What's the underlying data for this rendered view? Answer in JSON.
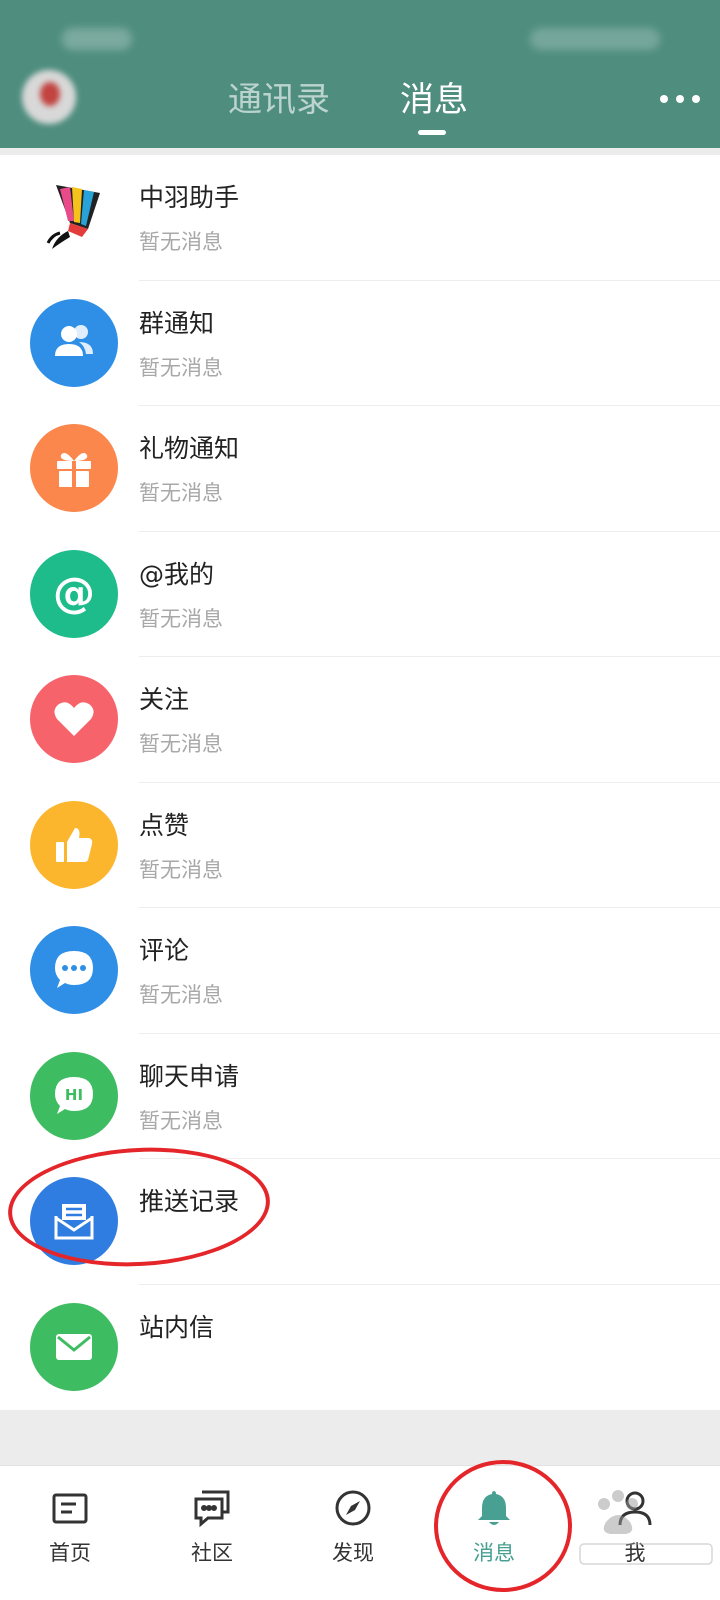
{
  "header": {
    "tabs": [
      {
        "label": "通讯录",
        "active": false
      },
      {
        "label": "消息",
        "active": true
      }
    ],
    "more_icon": "more-dots-icon",
    "background": "#4f8e7f"
  },
  "messages": [
    {
      "title": "中羽助手",
      "subtitle": "暂无消息",
      "icon": "shuttlecock-icon",
      "color": "#ffffff"
    },
    {
      "title": "群通知",
      "subtitle": "暂无消息",
      "icon": "group-icon",
      "color": "#2f8fe6"
    },
    {
      "title": "礼物通知",
      "subtitle": "暂无消息",
      "icon": "gift-icon",
      "color": "#fb874c"
    },
    {
      "title": "@我的",
      "subtitle": "暂无消息",
      "icon": "at-icon",
      "color": "#1ebc8a"
    },
    {
      "title": "关注",
      "subtitle": "暂无消息",
      "icon": "heart-icon",
      "color": "#f6636b"
    },
    {
      "title": "点赞",
      "subtitle": "暂无消息",
      "icon": "thumbs-up-icon",
      "color": "#fcb62d"
    },
    {
      "title": "评论",
      "subtitle": "暂无消息",
      "icon": "comment-icon",
      "color": "#2f8fe6"
    },
    {
      "title": "聊天申请",
      "subtitle": "暂无消息",
      "icon": "hi-chat-icon",
      "color": "#3ebc62",
      "hi_text": "HI"
    },
    {
      "title": "推送记录",
      "subtitle": "",
      "icon": "push-record-icon",
      "color": "#2f7de0"
    },
    {
      "title": "站内信",
      "subtitle": "",
      "icon": "mail-icon",
      "color": "#3ebc62"
    }
  ],
  "nav": [
    {
      "label": "首页",
      "icon": "home-icon",
      "active": false
    },
    {
      "label": "社区",
      "icon": "community-icon",
      "active": false
    },
    {
      "label": "发现",
      "icon": "compass-icon",
      "active": false
    },
    {
      "label": "消息",
      "icon": "bell-icon",
      "active": true
    },
    {
      "label": "我",
      "icon": "profile-icon",
      "active": false
    }
  ],
  "accent_color": "#47a092"
}
